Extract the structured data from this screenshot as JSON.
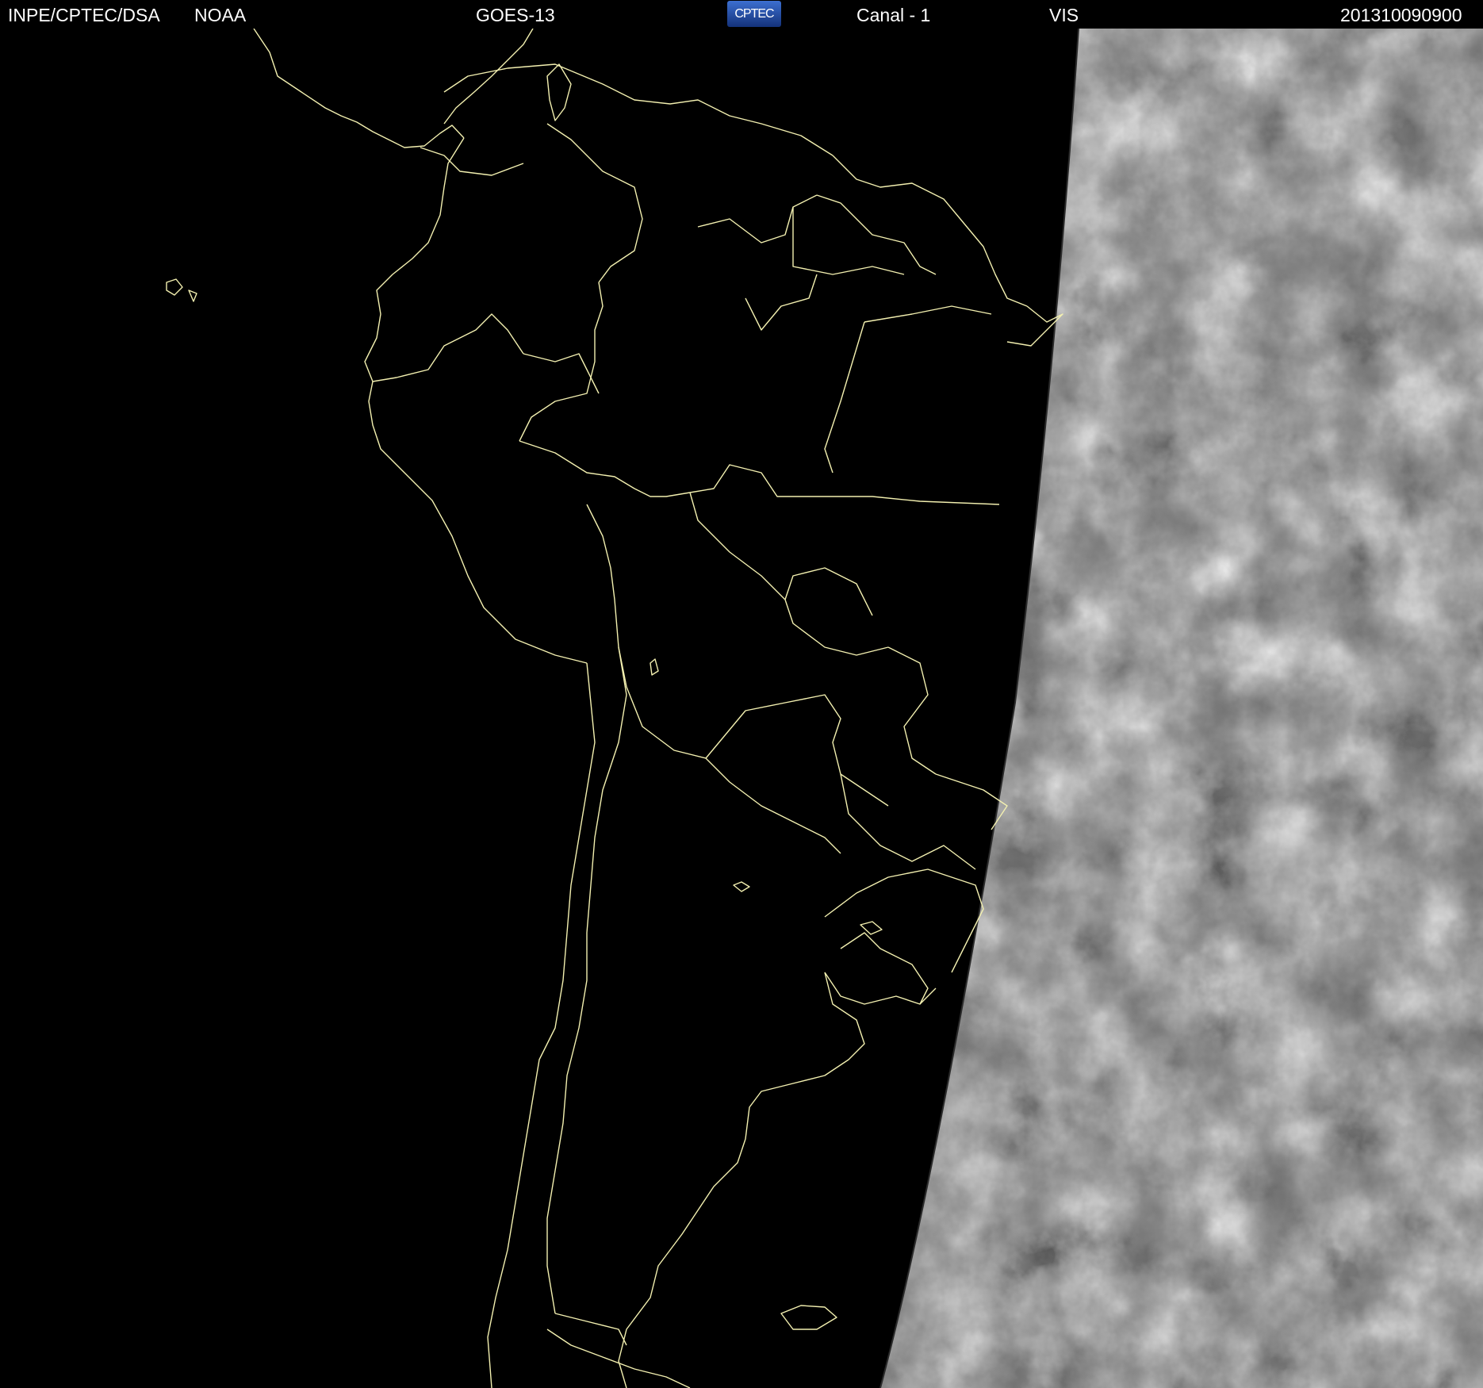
{
  "header": {
    "source": "INPE/CPTEC/DSA",
    "agency": "NOAA",
    "satellite": "GOES-13",
    "logo_text": "CPTEC",
    "channel": "Canal - 1",
    "band": "VIS",
    "timestamp": "201310090900"
  },
  "colors": {
    "background": "#000000",
    "border": "#f3f0b0",
    "header_text": "#ffffff",
    "logo": "#2a55b8",
    "cloud": "#e6e6e6",
    "ocean_day": "#6a6a6a"
  },
  "icons": {
    "logo": "cptec-logo"
  }
}
